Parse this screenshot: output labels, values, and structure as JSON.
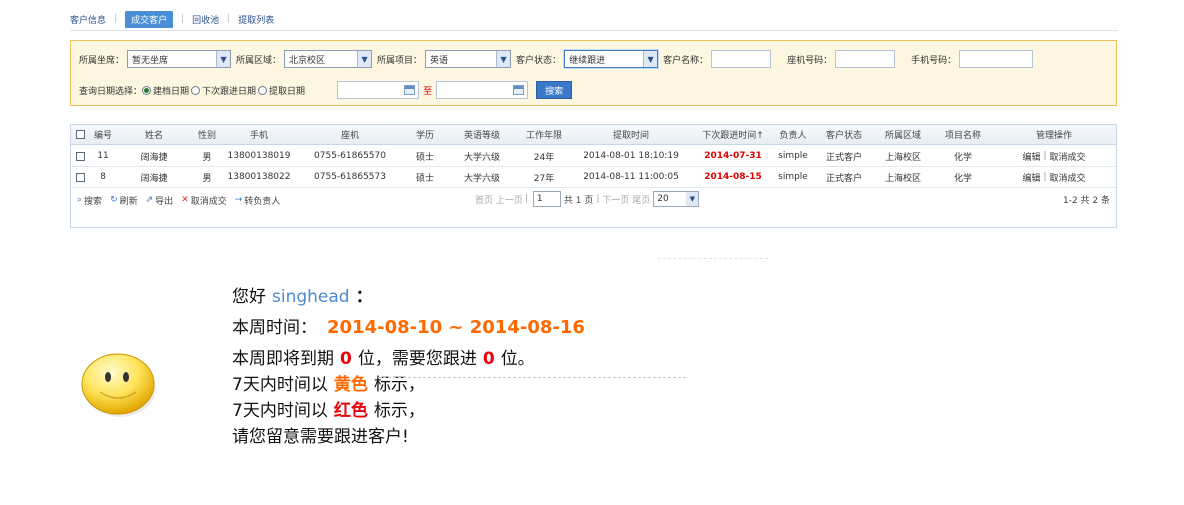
{
  "tabs": [
    {
      "label": "客户信息",
      "active": false
    },
    {
      "label": "成交客户",
      "active": true
    },
    {
      "label": "回收池",
      "active": false
    },
    {
      "label": "提取列表",
      "active": false
    }
  ],
  "filter": {
    "seat_label": "所属坐席：",
    "seat_value": "暂无坐席",
    "region_label": "所属区域：",
    "region_value": "北京校区",
    "project_label": "所属项目：",
    "project_value": "英语",
    "status_label": "客户状态：",
    "status_value": "继续跟进",
    "name_label": "客户名称：",
    "phone_label": "座机号码：",
    "mobile_label": "手机号码：",
    "date_choice_label": "查询日期选择：",
    "radio1": "建档日期",
    "radio2": "下次跟进日期",
    "radio3": "提取日期",
    "to_label": "至",
    "search_button": "搜索"
  },
  "grid": {
    "headers": [
      "编号",
      "姓名",
      "性别",
      "手机",
      "座机",
      "学历",
      "英语等级",
      "工作年限",
      "提取时间",
      "下次跟进时间↑",
      "负责人",
      "客户状态",
      "所属区域",
      "项目名称",
      "管理操作"
    ],
    "rows": [
      {
        "id": "11",
        "name": "阔海捷",
        "gender": "男",
        "mobile": "13800138019",
        "phone": "0755-61865570",
        "edu": "硕士",
        "eng": "大学六级",
        "years": "24年",
        "extract": "2014-08-01 18:10:19",
        "next": "2014-07-31",
        "owner": "simple",
        "status": "正式客户",
        "region": "上海校区",
        "project": "化学",
        "op_edit": "编辑",
        "op_cancel": "取消成交"
      },
      {
        "id": "8",
        "name": "阔海捷",
        "gender": "男",
        "mobile": "13800138022",
        "phone": "0755-61865573",
        "edu": "硕士",
        "eng": "大学六级",
        "years": "27年",
        "extract": "2014-08-11 11:00:05",
        "next": "2014-08-15",
        "owner": "simple",
        "status": "正式客户",
        "region": "上海校区",
        "project": "化学",
        "op_edit": "编辑",
        "op_cancel": "取消成交"
      }
    ],
    "toolbar": {
      "search": "搜索",
      "refresh": "刷新",
      "export": "导出",
      "cancel": "取消成交",
      "transfer": "转负责人"
    },
    "pager": {
      "first_prev": "首页 上一页",
      "page_value": "1",
      "page_total": "共 1 页",
      "next_last": "下一页 尾页",
      "page_size": "20"
    },
    "count": "1-2  共 2 条"
  },
  "message": {
    "greeting_prefix": "您好",
    "username": "singhead",
    "greeting_suffix": "：",
    "week_label": "本周时间：",
    "week_range": "2014-08-10 ~ 2014-08-16",
    "expire_prefix": "本周即将到期",
    "expire_count": "0",
    "expire_mid": "位，需要您跟进",
    "follow_count": "0",
    "expire_suffix": "位。",
    "yellow_prefix": "7天内时间以",
    "yellow_word": "黄色",
    "yellow_suffix": "标示，",
    "red_prefix": "7天内时间以",
    "red_word": "红色",
    "red_suffix": "标示，",
    "final": "请您留意需要跟进客户!"
  },
  "colors": {
    "accent_blue": "#3a78c8",
    "highlight_red": "#e8000b",
    "highlight_orange": "#ff6a00",
    "filter_bg": "#fdf6e0",
    "filter_border": "#f0c060"
  }
}
